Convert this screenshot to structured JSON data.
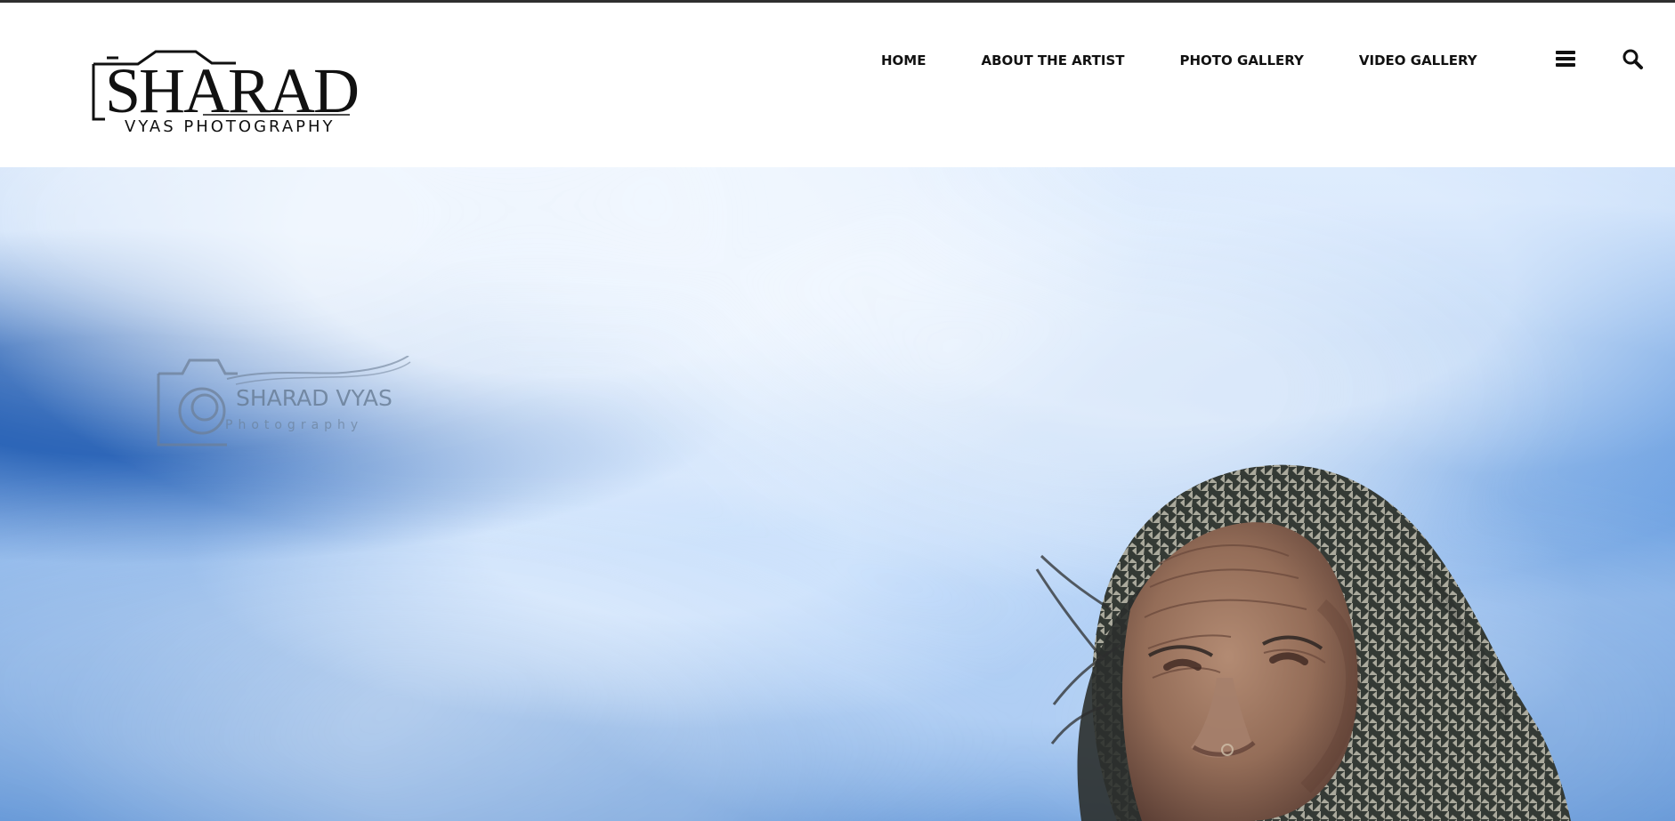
{
  "brand": {
    "name": "SHARAD",
    "subtitle": "VYAS PHOTOGRAPHY"
  },
  "navigation": {
    "items": [
      {
        "label": "HOME"
      },
      {
        "label": "ABOUT THE ARTIST"
      },
      {
        "label": "PHOTO GALLERY"
      },
      {
        "label": "VIDEO GALLERY"
      }
    ]
  },
  "header_icons": {
    "menu": "hamburger-menu-icon",
    "search": "search-icon"
  },
  "hero": {
    "watermark": {
      "title": "SHARAD VYAS",
      "subtitle": "Photography"
    },
    "subject": "elderly woman with patterned headscarf"
  },
  "colors": {
    "top_rule": "#2f2f2f",
    "nav_text": "#111111",
    "sky_light": "#dcecff",
    "sky_dark": "#2f6fc7",
    "scarf_light": "#a7a69a",
    "scarf_dark": "#333832",
    "skin": "#9d7963"
  }
}
